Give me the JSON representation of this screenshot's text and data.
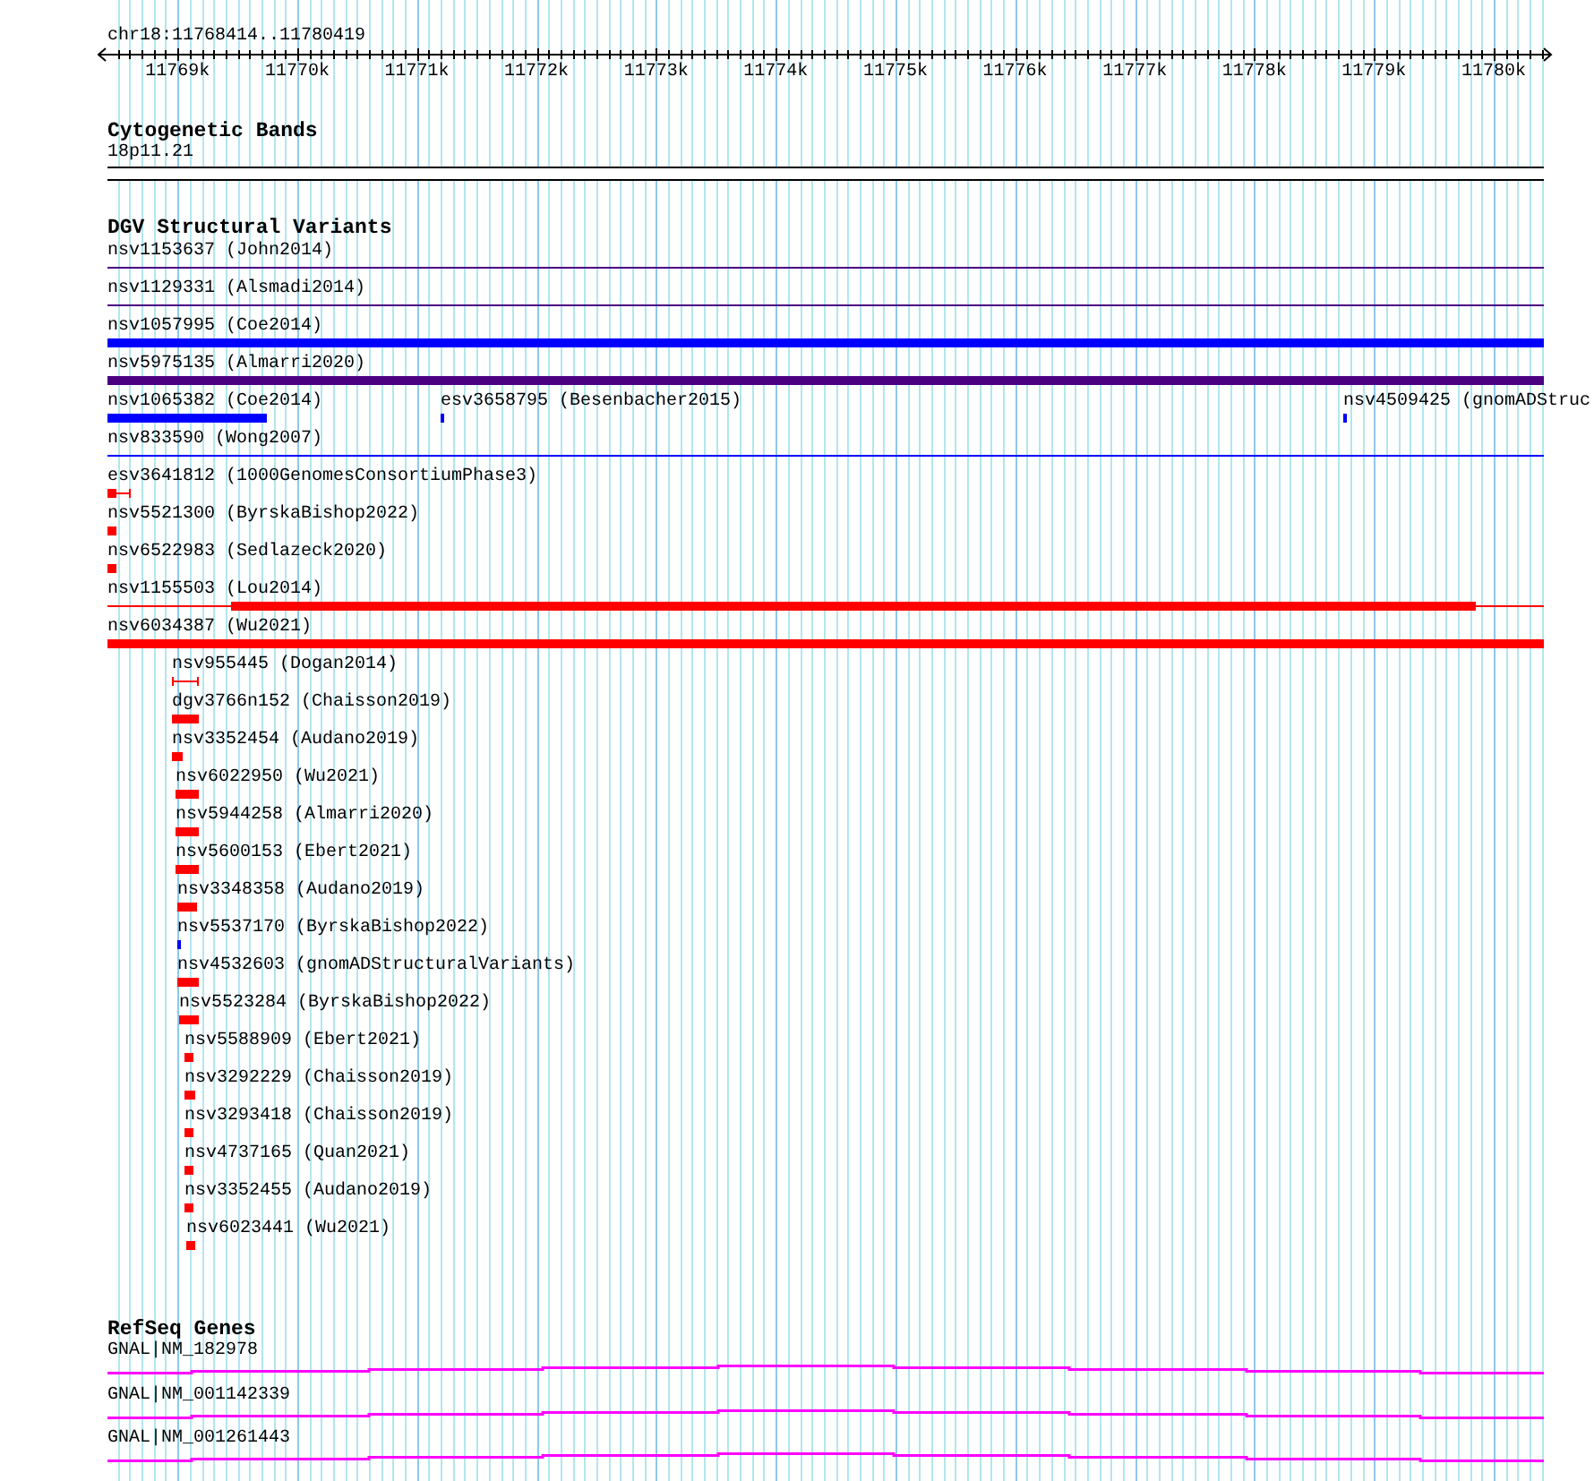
{
  "ruler": {
    "location": "chr18:11768414..11780419",
    "ticks": [
      "11769k",
      "11770k",
      "11771k",
      "11772k",
      "11773k",
      "11774k",
      "11775k",
      "11776k",
      "11777k",
      "11778k",
      "11779k",
      "11780k"
    ]
  },
  "cytoband_track": {
    "title": "Cytogenetic Bands",
    "band": "18p11.21"
  },
  "dgv_track": {
    "title": "DGV Structural Variants",
    "rows": [
      {
        "features": [
          {
            "label": "nsv1153637 (John2014)",
            "kind": "line",
            "color": "#4b0082"
          }
        ]
      },
      {
        "features": [
          {
            "label": "nsv1129331 (Alsmadi2014)",
            "kind": "line",
            "color": "#4b0082"
          }
        ]
      },
      {
        "features": [
          {
            "label": "nsv1057995 (Coe2014)",
            "kind": "bar",
            "color": "#0000ff"
          }
        ]
      },
      {
        "features": [
          {
            "label": "nsv5975135 (Almarri2020)",
            "kind": "bar",
            "color": "#4b0082"
          }
        ]
      },
      {
        "features": [
          {
            "label": "nsv1065382 (Coe2014)",
            "kind": "bar",
            "color": "#0000ff"
          },
          {
            "label": "esv3658795 (Besenbacher2015)",
            "kind": "bar",
            "color": "#0000ff"
          },
          {
            "label": "nsv4509425 (gnomADStruc",
            "kind": "bar",
            "color": "#0000ff"
          }
        ]
      },
      {
        "features": [
          {
            "label": "nsv833590 (Wong2007)",
            "kind": "line",
            "color": "#0000ff"
          }
        ]
      },
      {
        "features": [
          {
            "label": "esv3641812 (1000GenomesConsortiumPhase3)",
            "kind": "span",
            "color": "#ff0000"
          }
        ]
      },
      {
        "features": [
          {
            "label": "nsv5521300 (ByrskaBishop2022)",
            "kind": "bar",
            "color": "#ff0000"
          }
        ]
      },
      {
        "features": [
          {
            "label": "nsv6522983 (Sedlazeck2020)",
            "kind": "bar",
            "color": "#ff0000"
          }
        ]
      },
      {
        "features": [
          {
            "label": "nsv1155503 (Lou2014)",
            "kind": "span",
            "color": "#ff0000"
          }
        ]
      },
      {
        "features": [
          {
            "label": "nsv6034387 (Wu2021)",
            "kind": "bar",
            "color": "#ff0000"
          }
        ]
      },
      {
        "features": [
          {
            "label": "nsv955445 (Dogan2014)",
            "kind": "interval",
            "color": "#ff0000"
          }
        ]
      },
      {
        "features": [
          {
            "label": "dgv3766n152 (Chaisson2019)",
            "kind": "bar",
            "color": "#ff0000"
          }
        ]
      },
      {
        "features": [
          {
            "label": "nsv3352454 (Audano2019)",
            "kind": "bar",
            "color": "#ff0000"
          }
        ]
      },
      {
        "features": [
          {
            "label": "nsv6022950 (Wu2021)",
            "kind": "bar",
            "color": "#ff0000"
          }
        ]
      },
      {
        "features": [
          {
            "label": "nsv5944258 (Almarri2020)",
            "kind": "bar",
            "color": "#ff0000"
          }
        ]
      },
      {
        "features": [
          {
            "label": "nsv5600153 (Ebert2021)",
            "kind": "bar",
            "color": "#ff0000"
          }
        ]
      },
      {
        "features": [
          {
            "label": "nsv3348358 (Audano2019)",
            "kind": "bar",
            "color": "#ff0000"
          }
        ]
      },
      {
        "features": [
          {
            "label": "nsv5537170 (ByrskaBishop2022)",
            "kind": "bar",
            "color": "#0000ff"
          }
        ]
      },
      {
        "features": [
          {
            "label": "nsv4532603 (gnomADStructuralVariants)",
            "kind": "bar",
            "color": "#ff0000"
          }
        ]
      },
      {
        "features": [
          {
            "label": "nsv5523284 (ByrskaBishop2022)",
            "kind": "bar",
            "color": "#ff0000"
          }
        ]
      },
      {
        "features": [
          {
            "label": "nsv5588909 (Ebert2021)",
            "kind": "bar",
            "color": "#ff0000"
          }
        ]
      },
      {
        "features": [
          {
            "label": "nsv3292229 (Chaisson2019)",
            "kind": "bar",
            "color": "#ff0000"
          }
        ]
      },
      {
        "features": [
          {
            "label": "nsv3293418 (Chaisson2019)",
            "kind": "bar",
            "color": "#ff0000"
          }
        ]
      },
      {
        "features": [
          {
            "label": "nsv4737165 (Quan2021)",
            "kind": "bar",
            "color": "#ff0000"
          }
        ]
      },
      {
        "features": [
          {
            "label": "nsv3352455 (Audano2019)",
            "kind": "bar",
            "color": "#ff0000"
          }
        ]
      },
      {
        "features": [
          {
            "label": "nsv6023441 (Wu2021)",
            "kind": "bar",
            "color": "#ff0000"
          }
        ]
      }
    ]
  },
  "refseq_track": {
    "title": "RefSeq Genes",
    "genes": [
      {
        "label": "GNAL|NM_182978"
      },
      {
        "label": "GNAL|NM_001142339"
      },
      {
        "label": "GNAL|NM_001261443"
      }
    ]
  }
}
